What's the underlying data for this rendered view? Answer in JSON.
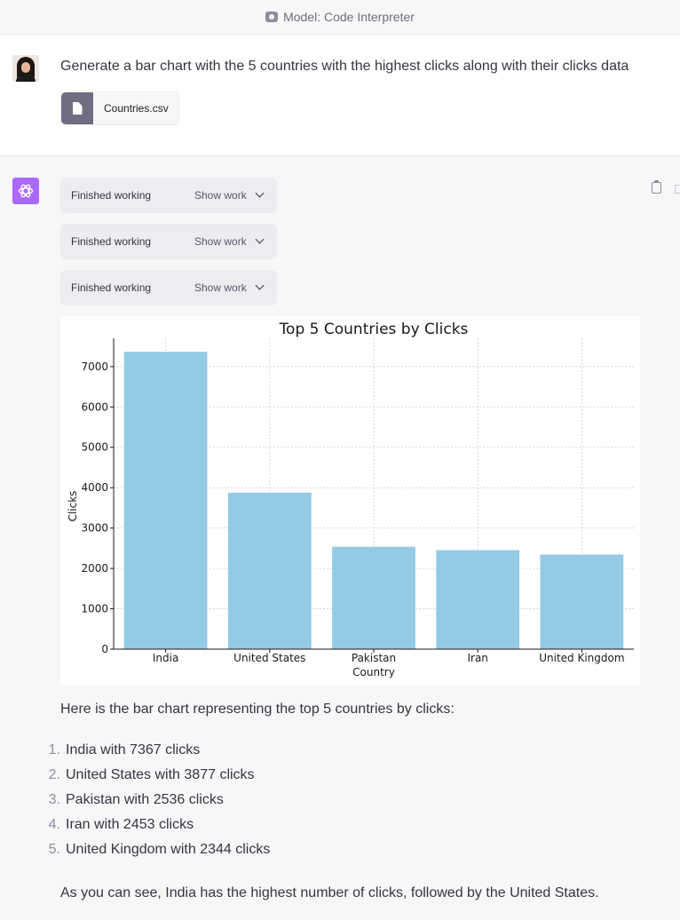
{
  "header": {
    "model_label": "Model: Code Interpreter",
    "model_icon": "plugin-icon"
  },
  "user_message": {
    "text": "Generate a bar chart with the 5 countries with the highest clicks along with their clicks data",
    "attachment": {
      "filename": "Countries.csv",
      "icon": "file-icon"
    }
  },
  "assistant": {
    "work_blocks": [
      {
        "status": "Finished working",
        "toggle": "Show work"
      },
      {
        "status": "Finished working",
        "toggle": "Show work"
      },
      {
        "status": "Finished working",
        "toggle": "Show work"
      }
    ],
    "summary": "Here is the bar chart representing the top 5 countries by clicks:",
    "list": [
      {
        "num": "1.",
        "text": "India with 7367 clicks"
      },
      {
        "num": "2.",
        "text": "United States with 3877 clicks"
      },
      {
        "num": "3.",
        "text": "Pakistan with 2536 clicks"
      },
      {
        "num": "4.",
        "text": "Iran with 2453 clicks"
      },
      {
        "num": "5.",
        "text": "United Kingdom with 2344 clicks"
      }
    ],
    "conclusion": "As you can see, India has the highest number of clicks, followed by the United States."
  },
  "chart_data": {
    "type": "bar",
    "title": "Top 5 Countries by Clicks",
    "xlabel": "Country",
    "ylabel": "Clicks",
    "categories": [
      "India",
      "United States",
      "Pakistan",
      "Iran",
      "United Kingdom"
    ],
    "values": [
      7367,
      3877,
      2536,
      2453,
      2344
    ],
    "ylim": [
      0,
      7700
    ],
    "yticks": [
      0,
      1000,
      2000,
      3000,
      4000,
      5000,
      6000,
      7000
    ],
    "grid": true,
    "bar_color": "#95cae6"
  },
  "colors": {
    "assistant_bg": "#f7f7f8",
    "gpt_brand": "#ab68ff",
    "text": "#343541"
  }
}
